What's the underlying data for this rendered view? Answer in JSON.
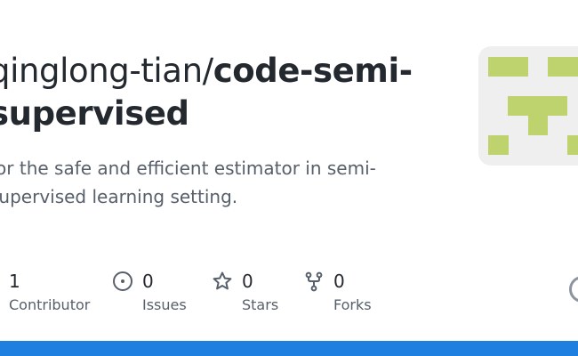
{
  "repo": {
    "owner": "qinglong-tian/",
    "name_part1": "code-semi-",
    "name_part2": "supervised",
    "description_line1": "for the safe and efficient estimator in semi-",
    "description_line2": "supervised learning setting."
  },
  "stats": [
    {
      "icon": "people-icon",
      "value": "1",
      "label": "Contributor"
    },
    {
      "icon": "issue-icon",
      "value": "0",
      "label": "Issues"
    },
    {
      "icon": "star-icon",
      "value": "0",
      "label": "Stars"
    },
    {
      "icon": "fork-icon",
      "value": "0",
      "label": "Forks"
    }
  ],
  "colors": {
    "accent_bar": "#1f7fe0",
    "identicon_fill": "#bed26e",
    "identicon_bg": "#efefef",
    "muted_text": "#57606a"
  }
}
